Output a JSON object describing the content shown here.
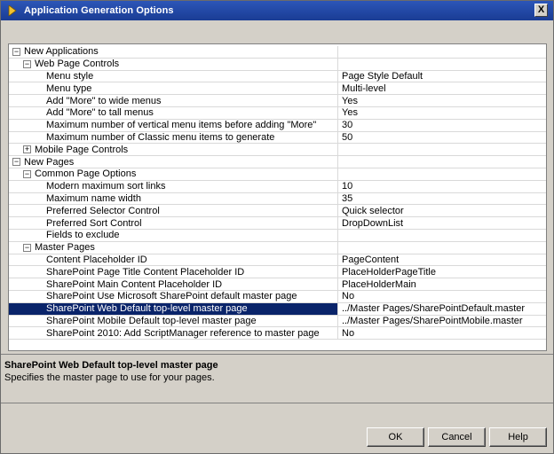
{
  "window": {
    "title": "Application Generation Options",
    "close_label": "X"
  },
  "grid": {
    "rows": [
      {
        "kind": "cat",
        "level": 0,
        "expander": "minus",
        "name": "New Applications",
        "value": ""
      },
      {
        "kind": "cat",
        "level": 1,
        "expander": "minus",
        "name": "Web Page Controls",
        "value": ""
      },
      {
        "kind": "prop",
        "level": 2,
        "name": "Menu style",
        "value": "Page Style Default"
      },
      {
        "kind": "prop",
        "level": 2,
        "name": "Menu type",
        "value": "Multi-level"
      },
      {
        "kind": "prop",
        "level": 2,
        "name": "Add \"More\" to wide menus",
        "value": "Yes"
      },
      {
        "kind": "prop",
        "level": 2,
        "name": "Add \"More\" to tall menus",
        "value": "Yes"
      },
      {
        "kind": "prop",
        "level": 2,
        "name": "Maximum number of vertical menu items before adding \"More\"",
        "value": "30"
      },
      {
        "kind": "prop",
        "level": 2,
        "name": "Maximum number of Classic menu items to generate",
        "value": "50"
      },
      {
        "kind": "cat",
        "level": 1,
        "expander": "plus",
        "name": "Mobile Page Controls",
        "value": ""
      },
      {
        "kind": "cat",
        "level": 0,
        "expander": "minus",
        "name": "New Pages",
        "value": ""
      },
      {
        "kind": "cat",
        "level": 1,
        "expander": "minus",
        "name": "Common Page Options",
        "value": ""
      },
      {
        "kind": "prop",
        "level": 2,
        "name": "Modern maximum sort links",
        "value": "10"
      },
      {
        "kind": "prop",
        "level": 2,
        "name": "Maximum name width",
        "value": "35"
      },
      {
        "kind": "prop",
        "level": 2,
        "name": "Preferred Selector Control",
        "value": "Quick selector"
      },
      {
        "kind": "prop",
        "level": 2,
        "name": "Preferred Sort Control",
        "value": "DropDownList"
      },
      {
        "kind": "prop",
        "level": 2,
        "name": "Fields to exclude",
        "value": ""
      },
      {
        "kind": "cat",
        "level": 1,
        "expander": "minus",
        "name": "Master Pages",
        "value": ""
      },
      {
        "kind": "prop",
        "level": 2,
        "name": "Content Placeholder ID",
        "value": "PageContent"
      },
      {
        "kind": "prop",
        "level": 2,
        "name": "SharePoint Page Title Content Placeholder ID",
        "value": "PlaceHolderPageTitle"
      },
      {
        "kind": "prop",
        "level": 2,
        "name": "SharePoint Main Content Placeholder ID",
        "value": "PlaceHolderMain"
      },
      {
        "kind": "prop",
        "level": 2,
        "name": "SharePoint Use Microsoft SharePoint default master page",
        "value": "No"
      },
      {
        "kind": "prop",
        "level": 2,
        "selected": true,
        "name": "SharePoint Web Default top-level master page",
        "value": "../Master Pages/SharePointDefault.master"
      },
      {
        "kind": "prop",
        "level": 2,
        "name": "SharePoint Mobile Default top-level master page",
        "value": "../Master Pages/SharePointMobile.master"
      },
      {
        "kind": "prop",
        "level": 2,
        "name": "SharePoint 2010: Add ScriptManager reference to master page",
        "value": "No"
      }
    ]
  },
  "description": {
    "title": "SharePoint Web Default top-level master page",
    "text": "Specifies the master page to use for your pages."
  },
  "buttons": {
    "ok": "OK",
    "cancel": "Cancel",
    "help": "Help"
  }
}
